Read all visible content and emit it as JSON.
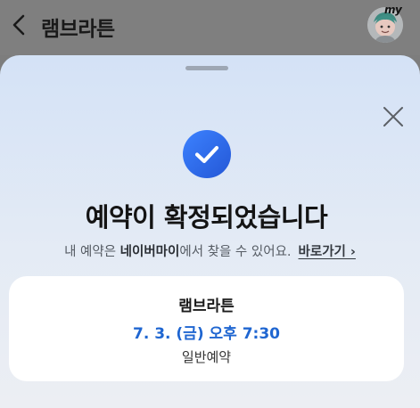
{
  "header": {
    "title": "램브라튼",
    "back_icon": "chevron-left-icon",
    "avatar_badge": "my"
  },
  "sheet": {
    "close_icon": "close-icon",
    "status_icon": "check-circle-icon",
    "headline": "예약이 확정되었습니다",
    "subline": {
      "prefix": "내 예약은 ",
      "highlight": "네이버마이",
      "suffix": "에서 찾을 수 있어요.",
      "link_label": "바로가기 ›"
    },
    "reservation": {
      "title": "램브라튼",
      "datetime": "7. 3. (금) 오후 7:30",
      "type": "일반예약"
    }
  },
  "colors": {
    "accent": "#1f66d1",
    "check_badge": "#2f6ef0",
    "overlay": "#7f7f7f"
  }
}
